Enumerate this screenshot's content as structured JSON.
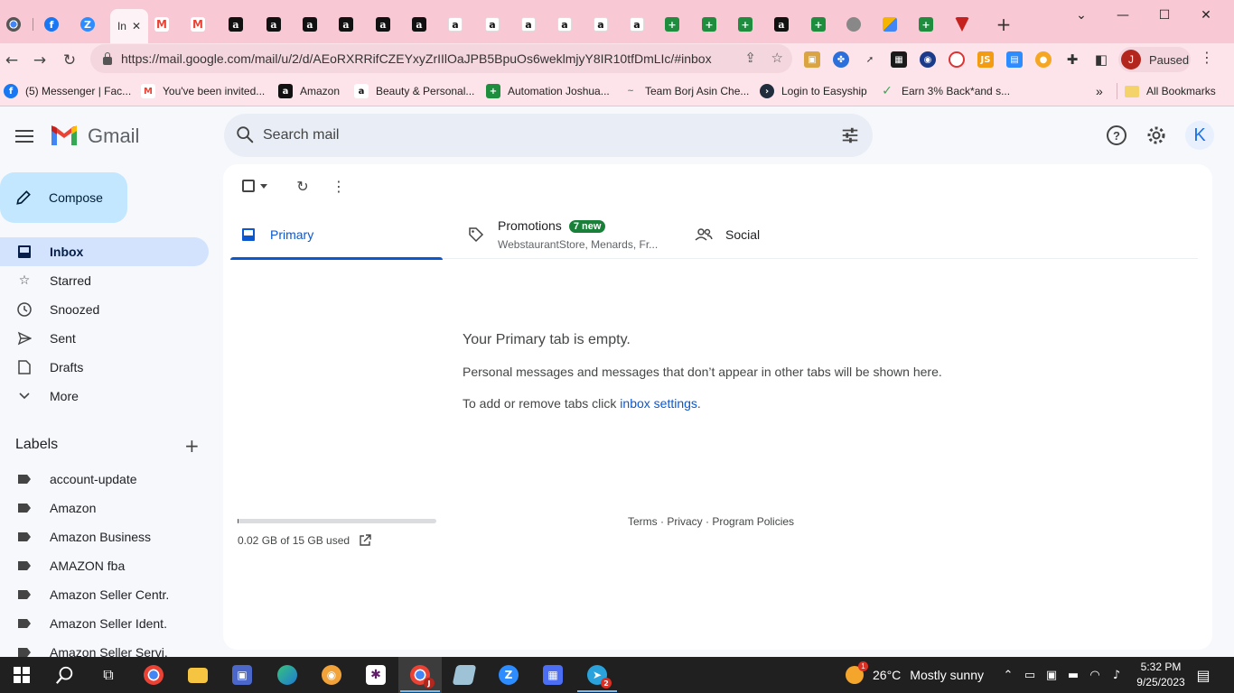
{
  "browser": {
    "active_tab_title": "In",
    "url": "https://mail.google.com/mail/u/2/d/AEoRXRRifCZEYxyZrIIlOaJPB5BpuOs6weklmjyY8IR10tfDmLIc/#inbox",
    "profile_initial": "J",
    "profile_status": "Paused",
    "bookmarks": [
      {
        "label": "(5) Messenger | Fac...",
        "icon": "facebook-icon"
      },
      {
        "label": "You've been invited...",
        "icon": "gmail-icon"
      },
      {
        "label": "Amazon",
        "icon": "amazon-icon"
      },
      {
        "label": "Beauty & Personal...",
        "icon": "amazon-icon"
      },
      {
        "label": "Automation Joshua...",
        "icon": "sheets-icon"
      },
      {
        "label": "Team Borj Asin Che...",
        "icon": "team-icon"
      },
      {
        "label": "Login to Easyship",
        "icon": "easyship-icon"
      },
      {
        "label": "Earn 3% Back*and s...",
        "icon": "cashback-icon"
      }
    ],
    "all_bookmarks": "All Bookmarks",
    "bookmarks_overflow": "»"
  },
  "gmail": {
    "wordmark": "Gmail",
    "search_placeholder": "Search mail",
    "account_initial": "K",
    "compose_label": "Compose",
    "nav": [
      {
        "label": "Inbox",
        "icon": "inbox-icon"
      },
      {
        "label": "Starred",
        "icon": "star-icon"
      },
      {
        "label": "Snoozed",
        "icon": "clock-icon"
      },
      {
        "label": "Sent",
        "icon": "send-icon"
      },
      {
        "label": "Drafts",
        "icon": "draft-icon"
      },
      {
        "label": "More",
        "icon": "chevron-down-icon"
      }
    ],
    "labels_heading": "Labels",
    "labels": [
      "account-update",
      "Amazon",
      "Amazon Business",
      "AMAZON fba",
      "Amazon Seller Centr.",
      "Amazon Seller Ident.",
      "Amazon Seller Servi."
    ],
    "tabs": {
      "primary": "Primary",
      "promotions": "Promotions",
      "promotions_badge": "7 new",
      "promotions_snippet": "WebstaurantStore, Menards, Fr...",
      "social": "Social"
    },
    "empty": {
      "title": "Your Primary tab is empty.",
      "description": "Personal messages and messages that don’t appear in other tabs will be shown here.",
      "settings_prefix": "To add or remove tabs click ",
      "settings_link": "inbox settings",
      "settings_suffix": "."
    },
    "storage": {
      "text": "0.02 GB of 15 GB used",
      "fraction_used": 0.0013
    },
    "footer": {
      "terms": "Terms",
      "privacy": "Privacy",
      "policies": "Program Policies",
      "separator": " · "
    }
  },
  "taskbar": {
    "weather_temp": "26°C",
    "weather_desc": "Mostly sunny",
    "weather_badge": "1",
    "time": "5:32 PM",
    "date": "9/25/2023",
    "chrome_badge": "J",
    "telegram_badge": "2"
  },
  "colors": {
    "accent": "#0b57d0",
    "compose_bg": "#c2e7ff",
    "active_nav_bg": "#d3e3fd",
    "badge_green": "#188038",
    "chrome_frame": "#f8c8d4"
  }
}
